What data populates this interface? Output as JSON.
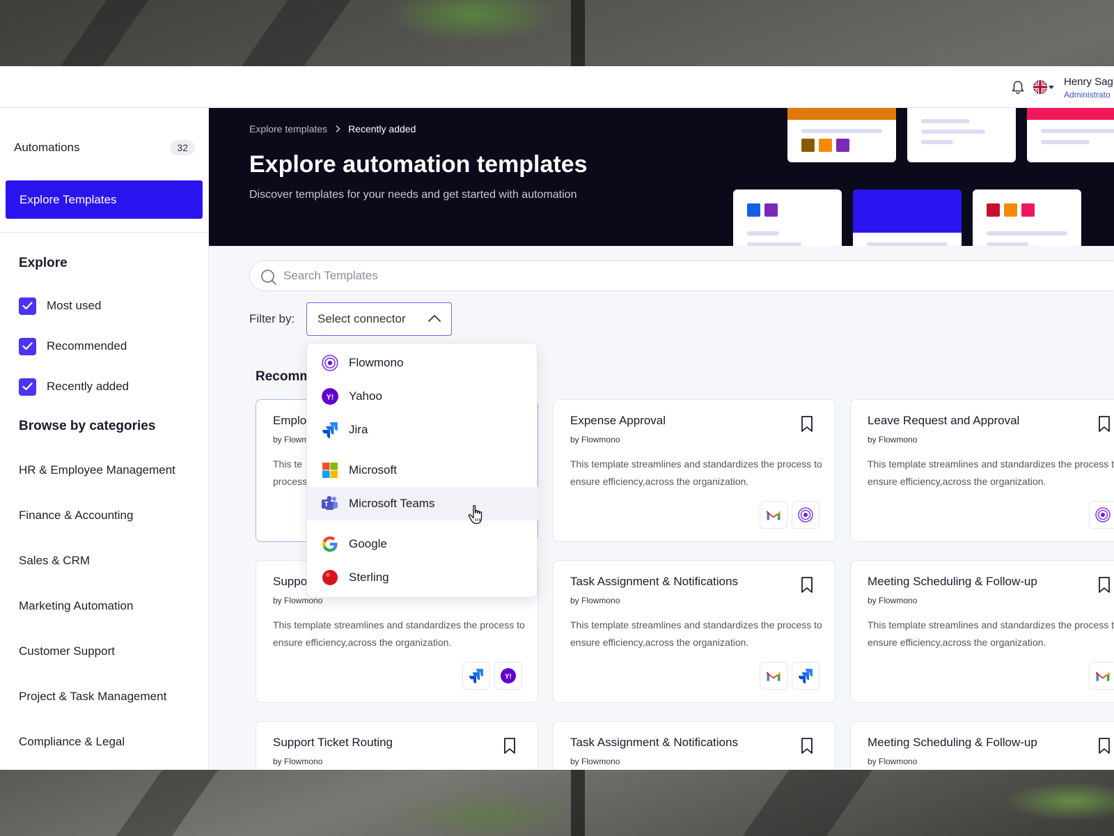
{
  "header": {
    "user_name": "Henry Sag",
    "user_role": "Administrato"
  },
  "sidebar": {
    "automations_label": "Automations",
    "automations_count": "32",
    "explore_templates_label": "Explore Templates",
    "explore_heading": "Explore",
    "explore_filters": [
      {
        "label": "Most used",
        "checked": true
      },
      {
        "label": "Recommended",
        "checked": true
      },
      {
        "label": "Recently added",
        "checked": true
      }
    ],
    "categories_heading": "Browse by categories",
    "categories": [
      "HR & Employee Management",
      "Finance & Accounting",
      "Sales & CRM",
      "Marketing Automation",
      "Customer Support",
      "Project & Task Management",
      "Compliance & Legal"
    ]
  },
  "hero": {
    "breadcrumb": [
      "Explore templates",
      "Recently added"
    ],
    "title": "Explore automation templates",
    "subtitle": "Discover templates for your needs and get started with automation"
  },
  "search": {
    "placeholder": "Search Templates"
  },
  "filter": {
    "label": "Filter by:",
    "selected": "Select connector",
    "options": [
      "Flowmono",
      "Yahoo",
      "Jira",
      "Microsoft",
      "Microsoft Teams",
      "Google",
      "Sterling"
    ],
    "hovered": "Microsoft Teams"
  },
  "section_title": "Recomm",
  "cards": [
    {
      "title": "Emplo",
      "by": "by Flowmo",
      "desc": "This te\nprocess",
      "connectors": []
    },
    {
      "title": "Expense Approval",
      "by": "by Flowmono",
      "desc": "This template streamlines and standardizes the process to ensure efficiency,across the organization.",
      "connectors": [
        "gmail-icon",
        "flowmono-icon"
      ]
    },
    {
      "title": "Leave Request and Approval",
      "by": "by Flowmono",
      "desc": "This template streamlines and standardizes the process to ensure efficiency,across the organization.",
      "connectors": [
        "flowmono-icon"
      ]
    },
    {
      "title": "Suppo",
      "by": "by Flowmono",
      "desc": "This template streamlines and standardizes the process to ensure efficiency,across the organization.",
      "connectors": [
        "jira-icon",
        "yahoo-icon"
      ]
    },
    {
      "title": "Task Assignment & Notifications",
      "by": "by Flowmono",
      "desc": "This template streamlines and standardizes the process to ensure efficiency,across the organization.",
      "connectors": [
        "gmail-icon",
        "jira-icon"
      ]
    },
    {
      "title": "Meeting Scheduling & Follow-up",
      "by": "by Flowmono",
      "desc": "This template streamlines and standardizes the process to ensure efficiency,across the organization.",
      "connectors": [
        "gmail-icon"
      ]
    },
    {
      "title": "Support Ticket Routing",
      "by": "by Flowmono",
      "desc": "",
      "connectors": []
    },
    {
      "title": "Task Assignment & Notifications",
      "by": "by Flowmono",
      "desc": "",
      "connectors": []
    },
    {
      "title": "Meeting Scheduling & Follow-up",
      "by": "by Flowmono",
      "desc": "",
      "connectors": []
    }
  ],
  "colors": {
    "accent": "#2a14f0",
    "checkbox": "#4a35f5",
    "hero_bg": "#0a0a1a"
  }
}
